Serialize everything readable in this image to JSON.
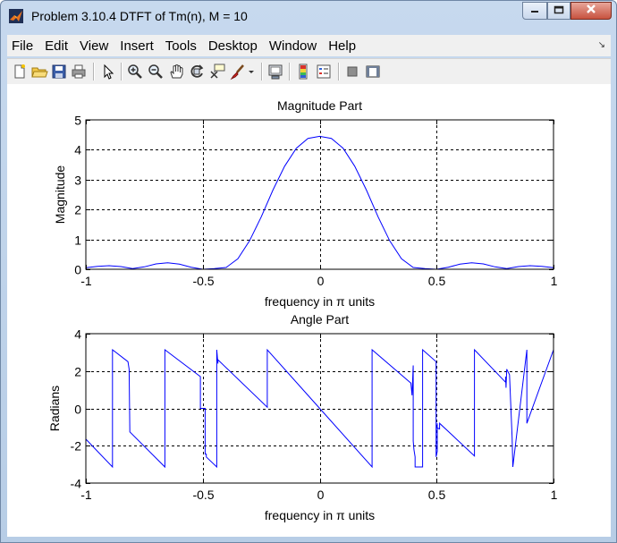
{
  "window": {
    "title": "Problem 3.10.4 DTFT of Tm(n), M = 10",
    "controls": [
      "minimize",
      "maximize",
      "close"
    ]
  },
  "menu": {
    "items": [
      "File",
      "Edit",
      "View",
      "Insert",
      "Tools",
      "Desktop",
      "Window",
      "Help"
    ]
  },
  "toolbar": {
    "icons": [
      "new-figure-icon",
      "open-file-icon",
      "save-icon",
      "print-icon",
      "pointer-icon",
      "zoom-in-icon",
      "zoom-out-icon",
      "pan-hand-icon",
      "rotate-3d-icon",
      "data-cursor-icon",
      "brush-icon",
      "brush-dropdown-icon",
      "link-plot-icon",
      "colorbar-icon",
      "legend-icon",
      "hide-plot-tools-icon",
      "show-plot-tools-icon"
    ]
  },
  "colors": {
    "line": "#0000ff",
    "title_bar": "#c4d6ec",
    "menu_bg": "#f0f0f0"
  },
  "chart_data": [
    {
      "type": "line",
      "title": "Magnitude Part",
      "xlabel": "frequency in π units",
      "ylabel": "Magnitude",
      "xlim": [
        -1,
        1
      ],
      "ylim": [
        0,
        5
      ],
      "xticks": [
        -1,
        -0.5,
        0,
        0.5,
        1
      ],
      "xtick_labels": [
        "-1",
        "-0.5",
        "0",
        "0.5",
        "1"
      ],
      "yticks": [
        0,
        1,
        2,
        3,
        4,
        5
      ],
      "ytick_labels": [
        "0",
        "1",
        "2",
        "3",
        "4",
        "5"
      ],
      "grid": true,
      "series": [
        {
          "color": "#0000ff",
          "x": [
            -1,
            -0.95,
            -0.9,
            -0.85,
            -0.8,
            -0.75,
            -0.7,
            -0.65,
            -0.6,
            -0.55,
            -0.5,
            -0.45,
            -0.4,
            -0.35,
            -0.3,
            -0.25,
            -0.2,
            -0.15,
            -0.1,
            -0.05,
            0,
            0.05,
            0.1,
            0.15,
            0.2,
            0.25,
            0.3,
            0.35,
            0.4,
            0.45,
            0.5,
            0.55,
            0.6,
            0.65,
            0.7,
            0.75,
            0.8,
            0.85,
            0.9,
            0.95,
            1
          ],
          "values": [
            0.05,
            0.1,
            0.12,
            0.09,
            0.02,
            0.08,
            0.18,
            0.22,
            0.17,
            0.07,
            0,
            0.02,
            0.06,
            0.35,
            0.95,
            1.75,
            2.65,
            3.45,
            4.05,
            4.38,
            4.45,
            4.38,
            4.05,
            3.45,
            2.65,
            1.75,
            0.95,
            0.35,
            0.06,
            0.02,
            0,
            0.07,
            0.17,
            0.22,
            0.18,
            0.08,
            0.02,
            0.09,
            0.12,
            0.1,
            0.05
          ]
        }
      ]
    },
    {
      "type": "line",
      "title": "Angle Part",
      "xlabel": "frequency in π units",
      "ylabel": "Radians",
      "xlim": [
        -1,
        1
      ],
      "ylim": [
        -4,
        4
      ],
      "xticks": [
        -1,
        -0.5,
        0,
        0.5,
        1
      ],
      "xtick_labels": [
        "-1",
        "-0.5",
        "0",
        "0.5",
        "1"
      ],
      "yticks": [
        -4,
        -2,
        0,
        2,
        4
      ],
      "ytick_labels": [
        "-4",
        "-2",
        "0",
        "2",
        "4"
      ],
      "grid": true,
      "series": [
        {
          "color": "#0000ff",
          "x": [
            -1,
            -0.886,
            -0.886,
            -0.82,
            -0.815,
            -0.812,
            -0.662,
            -0.662,
            -0.51,
            -0.51,
            -0.49,
            -0.49,
            -0.485,
            -0.485,
            -0.44,
            -0.44,
            -0.435,
            -0.435,
            -0.224,
            -0.224,
            0,
            0.224,
            0.224,
            0.39,
            0.395,
            0.4,
            0.4,
            0.403,
            0.408,
            0.408,
            0.44,
            0.44,
            0.498,
            0.498,
            0.503,
            0.503,
            0.502,
            0.513,
            0.513,
            0.662,
            0.662,
            0.795,
            0.795,
            0.797,
            0.8,
            0.812,
            0.823,
            0.826,
            0.886,
            0.886,
            1,
            1
          ],
          "values": [
            -1.65,
            -3.14,
            3.14,
            2.5,
            2.1,
            -1.26,
            -3.14,
            3.14,
            1.7,
            0,
            0,
            -2.45,
            -2.45,
            -2.6,
            -3.14,
            3.14,
            2.4,
            2.6,
            0.06,
            3.14,
            0,
            -3.14,
            3.14,
            1.35,
            0.7,
            2.3,
            -1.75,
            -2.2,
            -2.6,
            -3.14,
            -3.14,
            3.14,
            2.5,
            -2.6,
            -2.3,
            -0.8,
            -1.05,
            -1.1,
            -0.8,
            -2.55,
            3.14,
            1.4,
            1.7,
            1.1,
            2.1,
            1.8,
            -1.55,
            -3.14,
            3.14,
            -0.8,
            3.14,
            1.55
          ]
        }
      ]
    }
  ]
}
